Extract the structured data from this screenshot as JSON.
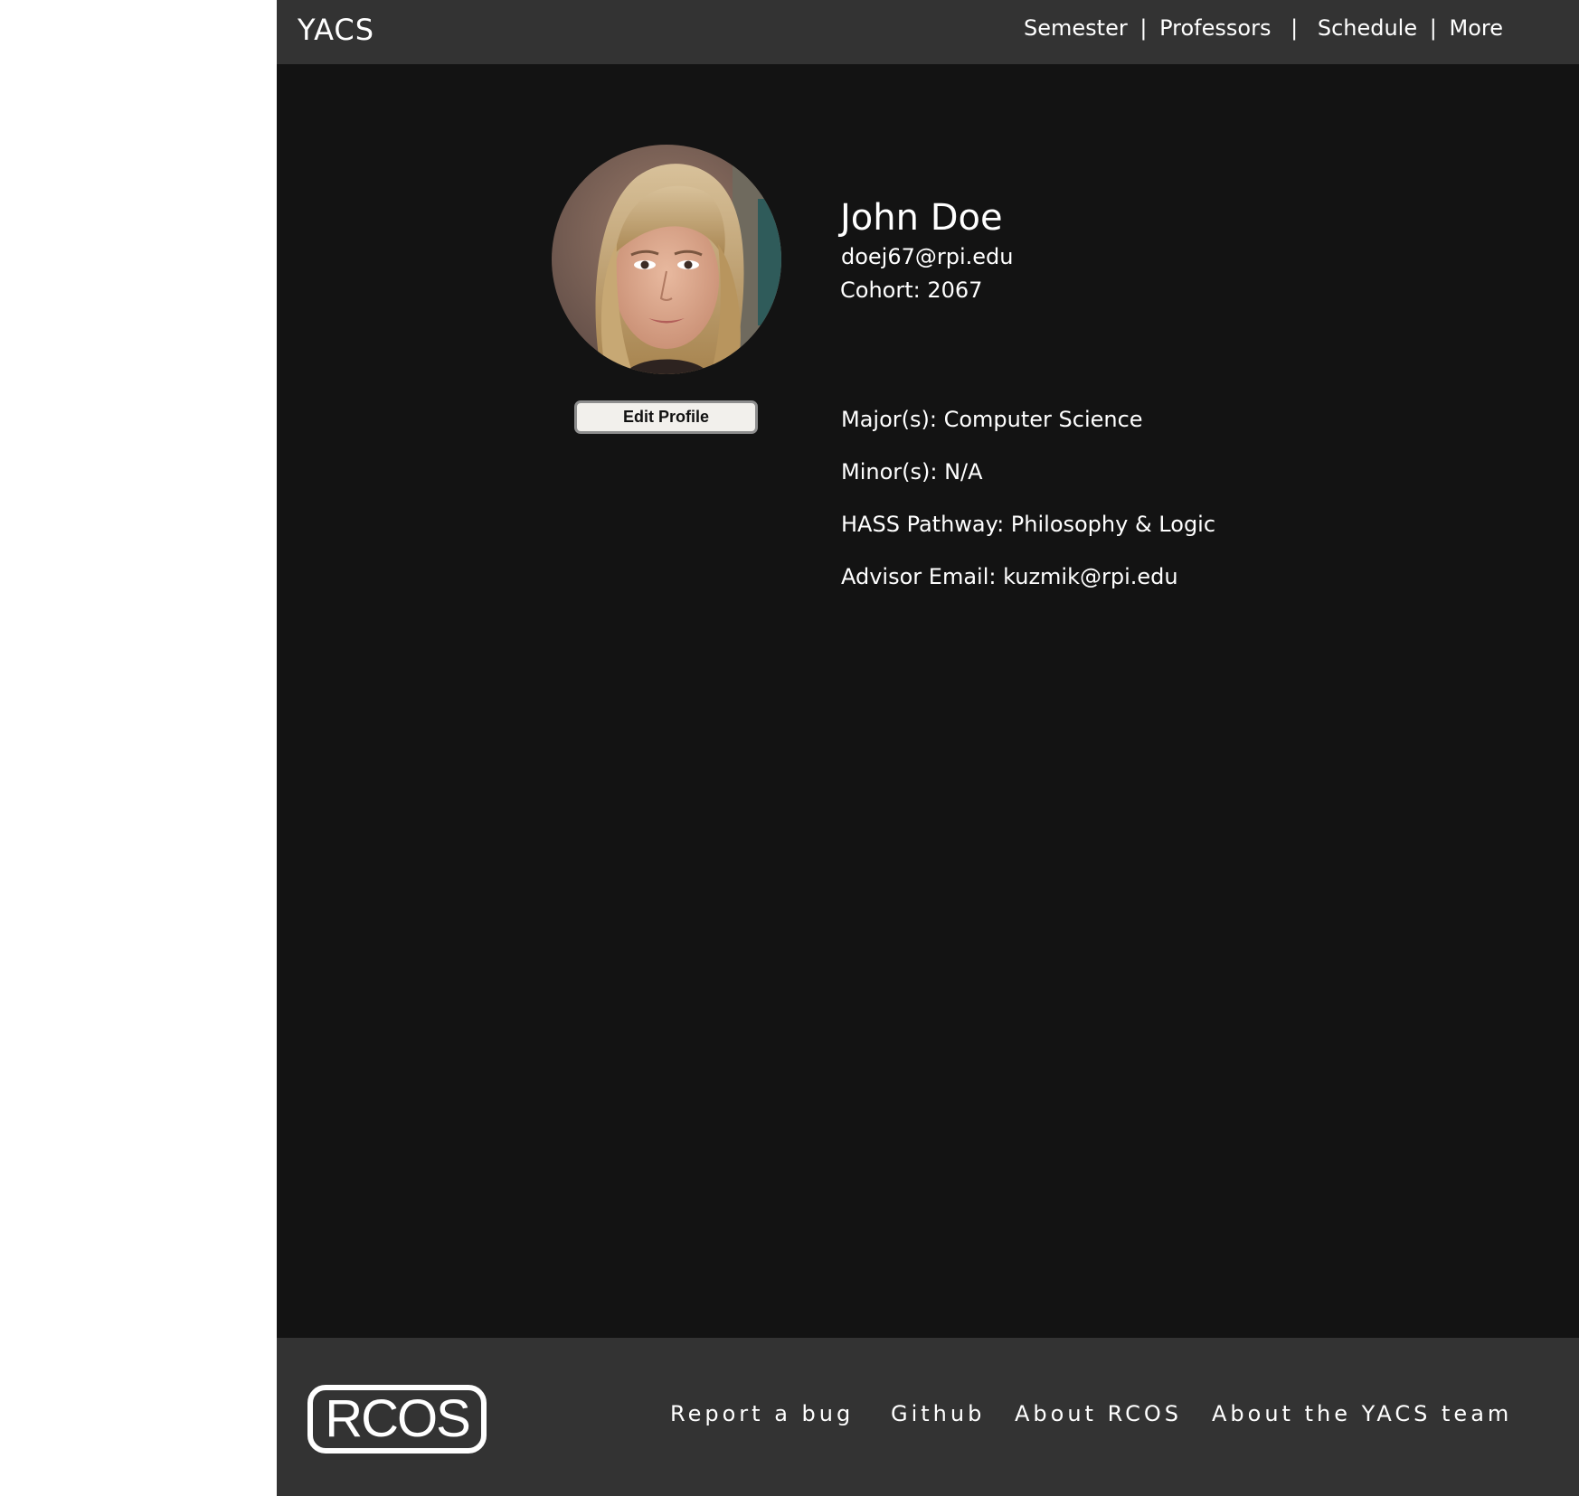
{
  "header": {
    "brand": "YACS",
    "nav": {
      "semester": "Semester",
      "professors": "Professors",
      "schedule": "Schedule",
      "more": "More",
      "separator": "|"
    }
  },
  "profile": {
    "name": "John Doe",
    "email": "doej67@rpi.edu",
    "cohort": "Cohort: 2067",
    "edit_label": "Edit Profile",
    "details": {
      "majors": "Major(s): Computer Science",
      "minors": "Minor(s): N/A",
      "hass": "HASS Pathway: Philosophy & Logic",
      "advisor": "Advisor Email: kuzmik@rpi.edu"
    }
  },
  "footer": {
    "logo": "RCOS",
    "links": {
      "report_bug": "Report a bug",
      "github": "Github",
      "about_rcos": "About RCOS",
      "about_team": "About the YACS team"
    }
  },
  "colors": {
    "page_bg": "#131313",
    "bar_bg": "#333333",
    "text": "#ffffff",
    "button_bg": "#f2f0ec"
  }
}
